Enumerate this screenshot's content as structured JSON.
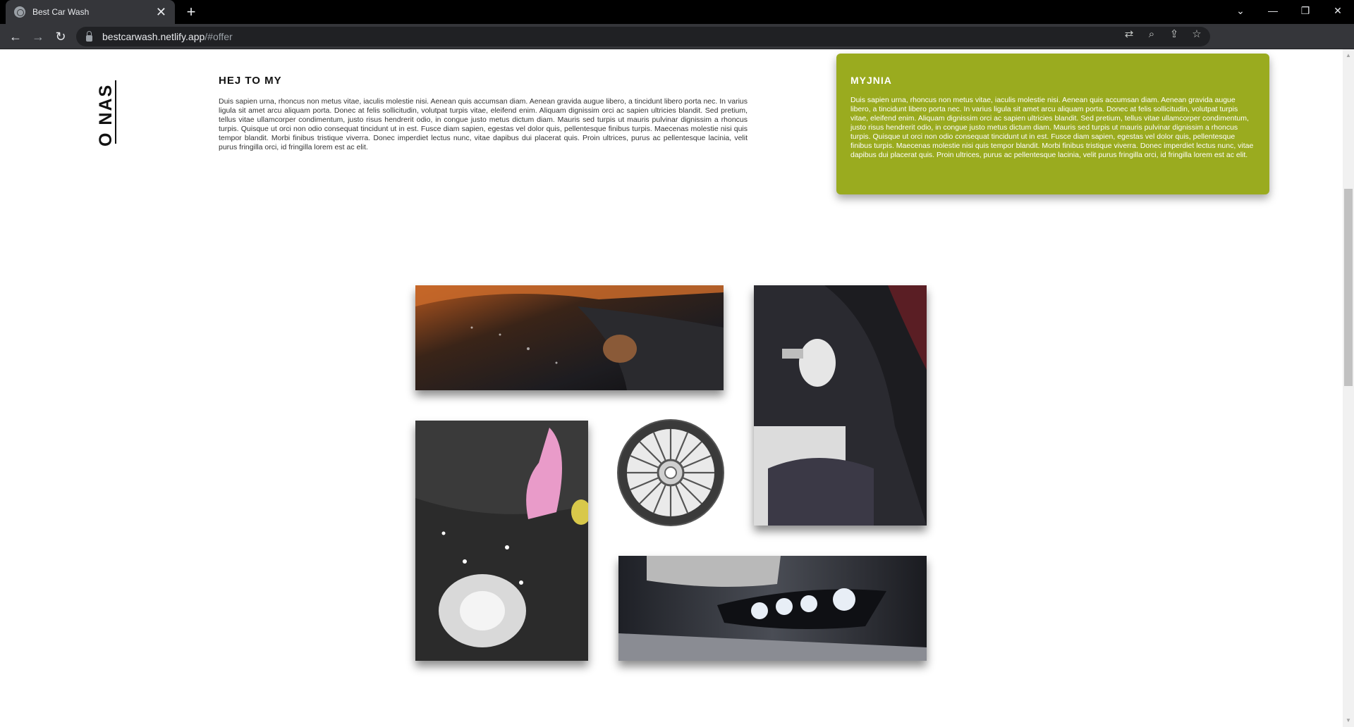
{
  "browser": {
    "tab_title": "Best Car Wash",
    "tab_close": "✕",
    "new_tab": "+",
    "url_host": "bestcarwash.netlify.app",
    "url_path": "/#offer",
    "back": "←",
    "forward": "→",
    "reload": "↻",
    "window_controls": {
      "list": "⌄",
      "minimize": "—",
      "restore": "❐",
      "close": "✕"
    },
    "omnibox_icons": {
      "translate": "⇄",
      "zoom": "⌕",
      "share": "⇪",
      "bookmark": "☆"
    }
  },
  "about": {
    "side_title": "O NAS",
    "heading": "HEJ TO MY",
    "text": "Duis sapien urna, rhoncus non metus vitae, iaculis molestie nisi. Aenean quis accumsan diam. Aenean gravida augue libero, a tincidunt libero porta nec. In varius ligula sit amet arcu aliquam porta. Donec at felis sollicitudin, volutpat turpis vitae, eleifend enim. Aliquam dignissim orci ac sapien ultricies blandit. Sed pretium, tellus vitae ullamcorper condimentum, justo risus hendrerit odio, in congue justo metus dictum diam. Mauris sed turpis ut mauris pulvinar dignissim a rhoncus turpis. Quisque ut orci non odio consequat tincidunt ut in est. Fusce diam sapien, egestas vel dolor quis, pellentesque finibus turpis. Maecenas molestie nisi quis tempor blandit. Morbi finibus tristique viverra. Donec imperdiet lectus nunc, vitae dapibus dui placerat quis. Proin ultrices, purus ac pellentesque lacinia, velit purus fringilla orci, id fringilla lorem est ac elit."
  },
  "offer_card": {
    "heading": "MYJNIA",
    "text": "Duis sapien urna, rhoncus non metus vitae, iaculis molestie nisi. Aenean quis accumsan diam. Aenean gravida augue libero, a tincidunt libero porta nec. In varius ligula sit amet arcu aliquam porta. Donec at felis sollicitudin, volutpat turpis vitae, eleifend enim. Aliquam dignissim orci ac sapien ultricies blandit. Sed pretium, tellus vitae ullamcorper condimentum, justo risus hendrerit odio, in congue justo metus dictum diam. Mauris sed turpis ut mauris pulvinar dignissim a rhoncus turpis. Quisque ut orci non odio consequat tincidunt ut in est. Fusce diam sapien, egestas vel dolor quis, pellentesque finibus turpis. Maecenas molestie nisi quis tempor blandit. Morbi finibus tristique viverra. Donec imperdiet lectus nunc, vitae dapibus dui placerat quis. Proin ultrices, purus ac pellentesque lacinia, velit purus fringilla orci, id fringilla lorem est ac elit.",
    "color": "#9aab1f"
  }
}
